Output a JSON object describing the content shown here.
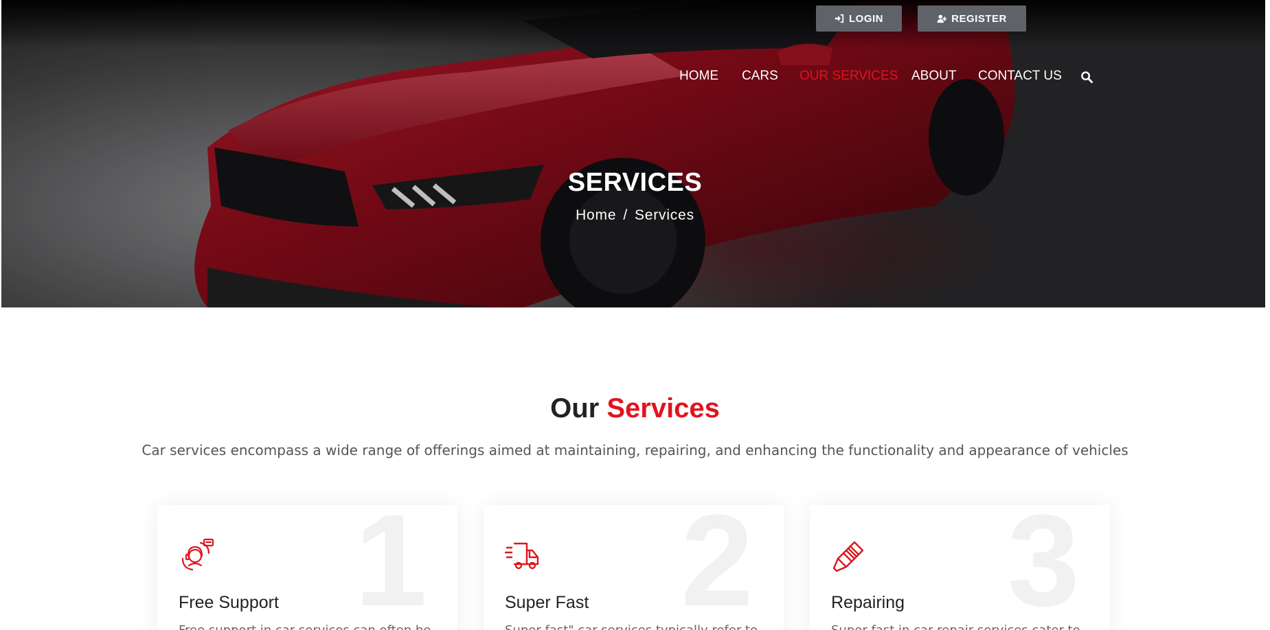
{
  "auth": {
    "login_label": "LOGIN",
    "register_label": "REGISTER"
  },
  "nav": {
    "items": [
      {
        "label": "HOME",
        "active": false
      },
      {
        "label": "CARS",
        "active": false
      },
      {
        "label": "OUR SERVICES",
        "active": true
      },
      {
        "label": "ABOUT",
        "active": false
      },
      {
        "label": "CONTACT US",
        "active": false
      }
    ],
    "search_icon": "search-icon"
  },
  "hero": {
    "title": "SERVICES",
    "breadcrumb": {
      "home": "Home",
      "separator": "/",
      "current": "Services"
    }
  },
  "services": {
    "title_plain": "Our",
    "title_accent": "Services",
    "description": "Car services encompass a wide range of offerings aimed at maintaining, repairing, and enhancing the functionality and appearance of vehicles",
    "cards": [
      {
        "number": "1",
        "icon": "support-agent-icon",
        "title": "Free Support",
        "text": "Free support in car services can often be"
      },
      {
        "number": "2",
        "icon": "delivery-truck-icon",
        "title": "Super Fast",
        "text": "Super fast\" car services typically refer to"
      },
      {
        "number": "3",
        "icon": "spark-plug-icon",
        "title": "Repairing",
        "text": "Super fast in car repair services cater to"
      }
    ]
  },
  "colors": {
    "accent": "#e0141e",
    "heading": "#222222",
    "button_bg": "#5f6369"
  }
}
